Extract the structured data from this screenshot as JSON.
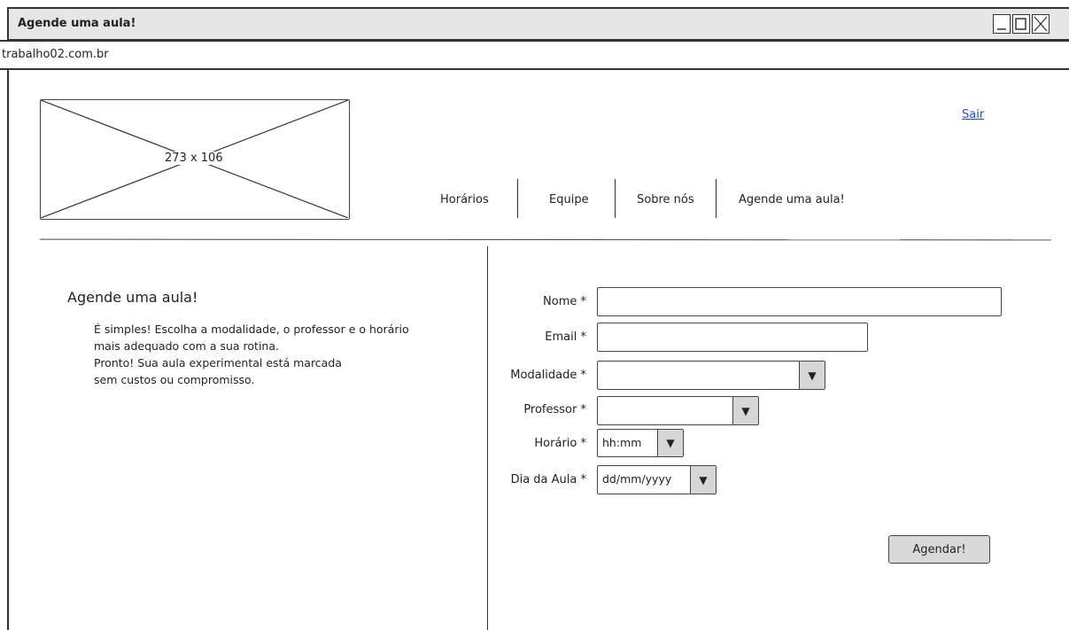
{
  "window": {
    "title": "Agende uma aula!"
  },
  "address_bar": {
    "url": "trabalho02.com.br"
  },
  "logo": {
    "label": "273 x 106"
  },
  "header": {
    "logout_label": "Sair"
  },
  "nav": {
    "items": [
      "Horários",
      "Equipe",
      "Sobre nós",
      "Agende uma aula!"
    ]
  },
  "intro": {
    "title": "Agende uma aula!",
    "lines": [
      "É simples! Escolha a modalidade, o professor e o horário",
      "mais adequado com a sua rotina.",
      "Pronto! Sua aula experimental está marcada",
      "sem custos ou compromisso."
    ]
  },
  "form": {
    "nome_label": "Nome *",
    "email_label": "Email *",
    "modalidade_label": "Modalidade *",
    "professor_label": "Professor *",
    "horario_label": "Horário *",
    "horario_value": "hh:mm",
    "dia_label": "Dia da Aula *",
    "dia_value": "dd/mm/yyyy",
    "submit_label": "Agendar!"
  },
  "icons": {
    "dropdown": "chevron-down-icon",
    "minimize": "minimize-icon",
    "maximize": "maximize-icon",
    "close": "close-icon"
  }
}
